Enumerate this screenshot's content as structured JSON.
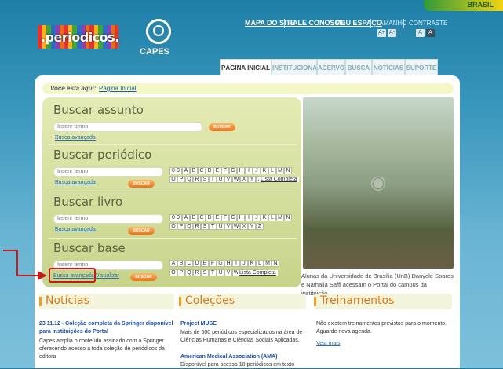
{
  "brand": {
    "logo_text": ".periodicos.",
    "capes_label": "CAPES",
    "brasil_label": "BRASIL"
  },
  "top_nav": {
    "links": [
      "MAPA DO SITE",
      "FALE CONOSCO",
      "MEU ESPAÇO"
    ],
    "tamanho_label": "TAMANHO",
    "tamanho_buttons": [
      "A+",
      "A-"
    ],
    "contraste_label": "CONTRASTE",
    "contraste_buttons": [
      "A",
      "A"
    ]
  },
  "tabs": [
    "PÁGINA INICIAL",
    "INSTITUCIONAL",
    "ACERVO",
    "BUSCA",
    "NOTÍCIAS",
    "SUPORTE"
  ],
  "active_tab": "PÁGINA INICIAL",
  "breadcrumb": {
    "label": "Você está aqui:",
    "link": "Página Inicial"
  },
  "search": {
    "assunto": {
      "title": "Buscar assunto",
      "placeholder": "Inserir termo",
      "advanced": "Busca avançada",
      "button": "BUSCAR"
    },
    "periodico": {
      "title": "Buscar periódico",
      "placeholder": "Inserir termo",
      "advanced": "Busca avançada",
      "button": "BUSCAR"
    },
    "livro": {
      "title": "Buscar livro",
      "placeholder": "Inserir termo",
      "advanced": "Busca avançada",
      "button": "BUSCAR"
    },
    "base": {
      "title": "Buscar base",
      "placeholder": "Inserir termo",
      "advanced": "Busca avançada",
      "visualizar": "Visualizar",
      "button": "BUSCAR"
    },
    "alphabet_row1_a": [
      "0-9",
      "A",
      "B",
      "C",
      "D",
      "E",
      "F",
      "G",
      "H",
      "I",
      "J",
      "K",
      "L",
      "M",
      "N"
    ],
    "alphabet_row2_a": [
      "O",
      "P",
      "Q",
      "R",
      "S",
      "T",
      "U",
      "V",
      "W",
      "X",
      "Y",
      "Z"
    ],
    "alphabet_row1_b": [
      "0-9",
      "A",
      "B",
      "C",
      "D",
      "E",
      "F",
      "G",
      "H",
      "I",
      "J",
      "K",
      "L",
      "M",
      "N"
    ],
    "alphabet_row2_b": [
      "O",
      "P",
      "Q",
      "R",
      "S",
      "T",
      "U",
      "V",
      "W",
      "X",
      "Y",
      "Z"
    ],
    "alphabet_row1_c": [
      "A",
      "B",
      "C",
      "D",
      "E",
      "F",
      "G",
      "H",
      "I",
      "J",
      "K",
      "L",
      "M",
      "N"
    ],
    "alphabet_row2_c": [
      "O",
      "P",
      "Q",
      "R",
      "S",
      "T",
      "U",
      "V",
      "W",
      "X",
      "Y",
      "Z"
    ],
    "lista_completa": "Lista Completa"
  },
  "photo": {
    "icon": "photo-icon",
    "caption": "Alunas da Universidade de Brasília (UnB) Danyele Soares e Nathalia Saffi acessam o Portal do campus da instituição"
  },
  "columns": {
    "noticias": {
      "title": "Notícias",
      "date_headline": "23.11.12 - Coleção completa da Springer disponível para instituições do Portal",
      "text": "Capes amplia o conteúdo assinado com a Springer oferecendo acesso a toda coleção de periódicos da editora"
    },
    "colecoes": {
      "title": "Coleções",
      "item1_title": "Project MUSE",
      "item1_text": "Mais de 500 periódicos especializados na área de Ciências Humanas e Ciências Sociais Aplicadas.",
      "item2_title": "American Medical Association (AMA)",
      "item2_text": "Disponível para acesso 10 periódicos em texto"
    },
    "treinamentos": {
      "title": "Treinamentos",
      "text": "Não existem treinamentos previstos para o momento. Aguarde nova agenda.",
      "link": "Veja mais"
    }
  },
  "colors": {
    "accent": "#e07812",
    "highlight": "#c41b1b",
    "link": "#1a5fa0"
  }
}
